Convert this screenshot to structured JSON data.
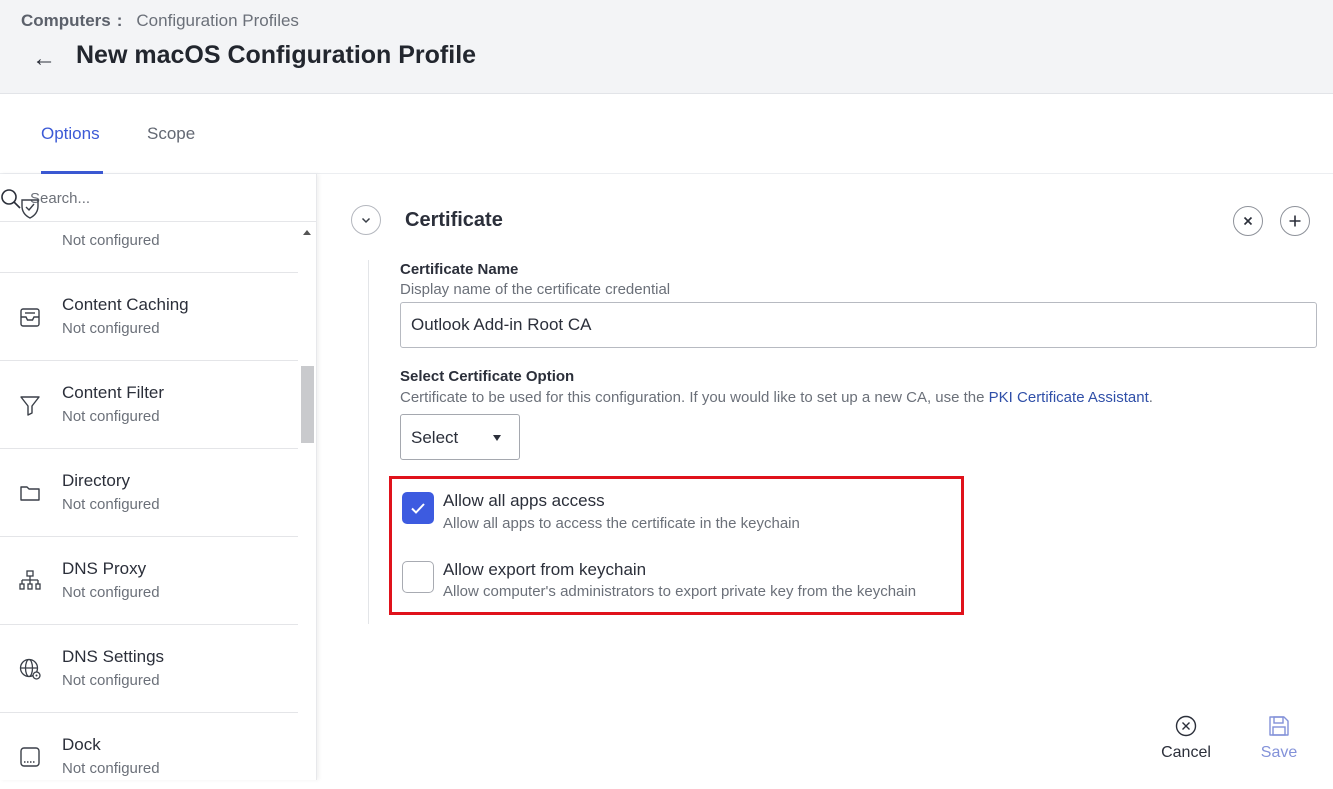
{
  "breadcrumb": {
    "root": "Computers",
    "separator": ":",
    "current": "Configuration Profiles"
  },
  "page": {
    "back_icon": "arrow-left-icon",
    "title": "New macOS Configuration Profile"
  },
  "tabs": [
    {
      "label": "Options",
      "active": true
    },
    {
      "label": "Scope",
      "active": false
    }
  ],
  "sidebar": {
    "search_placeholder": "Search...",
    "items": [
      {
        "name": "",
        "status": "Not configured",
        "icon": "shield-check-icon"
      },
      {
        "name": "Content Caching",
        "status": "Not configured",
        "icon": "inbox-tray-icon"
      },
      {
        "name": "Content Filter",
        "status": "Not configured",
        "icon": "filter-icon"
      },
      {
        "name": "Directory",
        "status": "Not configured",
        "icon": "folder-icon"
      },
      {
        "name": "DNS Proxy",
        "status": "Not configured",
        "icon": "network-tree-icon"
      },
      {
        "name": "DNS Settings",
        "status": "Not configured",
        "icon": "globe-gear-icon"
      },
      {
        "name": "Dock",
        "status": "Not configured",
        "icon": "dock-icon"
      }
    ]
  },
  "certificate": {
    "title": "Certificate",
    "name_label": "Certificate Name",
    "name_desc": "Display name of the certificate credential",
    "name_value": "Outlook Add-in Root CA",
    "option_label": "Select Certificate Option",
    "option_desc": "Certificate to be used for this configuration. If you would like to set up a new CA, use the",
    "option_link": "PKI Certificate Assistant",
    "option_desc_end": ".",
    "select_value": "Select",
    "checkboxes": [
      {
        "title": "Allow all apps access",
        "desc": "Allow all apps to access the certificate in the keychain",
        "checked": true
      },
      {
        "title": "Allow export from keychain",
        "desc": "Allow computer's administrators to export private key from the keychain",
        "checked": false
      }
    ]
  },
  "footer": {
    "cancel_label": "Cancel",
    "save_label": "Save"
  },
  "colors": {
    "accent": "#3c5ad6",
    "highlight_border": "#e0121b",
    "save_text": "#8392d9"
  }
}
